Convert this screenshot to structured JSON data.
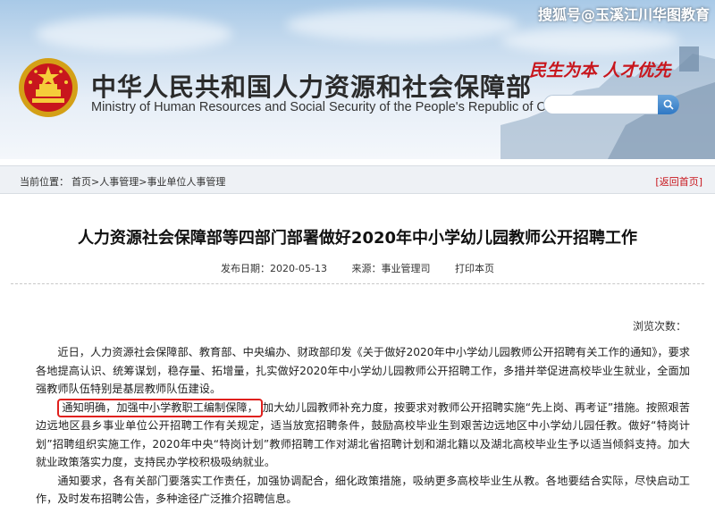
{
  "watermark": "搜狐号@玉溪江川华图教育",
  "header": {
    "ministry_cn": "中华人民共和国人力资源和社会保障部",
    "ministry_en": "Ministry of Human Resources and Social Security of the People's Republic of China",
    "slogan": "民生为本 人才优先"
  },
  "breadcrumb": {
    "label": "当前位置：",
    "items": [
      "首页",
      "人事管理",
      "事业单位人事管理"
    ],
    "separator": ">",
    "back_home": "[返回首页]"
  },
  "article": {
    "title": "人力资源社会保障部等四部门部署做好2020年中小学幼儿园教师公开招聘工作",
    "publish_date_label": "发布日期：",
    "publish_date": "2020-05-13",
    "source_label": "来源：",
    "source": "事业管理司",
    "print_label": "打印本页",
    "view_count_label": "浏览次数：",
    "para1": "近日，人力资源社会保障部、教育部、中央编办、财政部印发《关于做好2020年中小学幼儿园教师公开招聘有关工作的通知》，要求各地提高认识、统筹谋划，稳存量、拓增量，扎实做好2020年中小学幼儿园教师公开招聘工作，多措并举促进高校毕业生就业，全面加强教师队伍特别是基层教师队伍建设。",
    "para2_highlight": "通知明确，加强中小学教职工编制保障，",
    "para2_rest": "加大幼儿园教师补充力度，按要求对教师公开招聘实施“先上岗、再考证”措施。按照艰苦边远地区县乡事业单位公开招聘工作有关规定，适当放宽招聘条件，鼓励高校毕业生到艰苦边远地区中小学幼儿园任教。做好“特岗计划”招聘组织实施工作，2020年中央“特岗计划”教师招聘工作对湖北省招聘计划和湖北籍以及湖北高校毕业生予以适当倾斜支持。加大就业政策落实力度，支持民办学校积极吸纳就业。",
    "para3": "通知要求，各有关部门要落实工作责任，加强协调配合，细化政策措施，吸纳更多高校毕业生从教。各地要结合实际，尽快启动工作，及时发布招聘公告，多种途径广泛推介招聘信息。"
  },
  "colors": {
    "accent_red": "#c8161d",
    "highlight_border": "#e0201d"
  }
}
